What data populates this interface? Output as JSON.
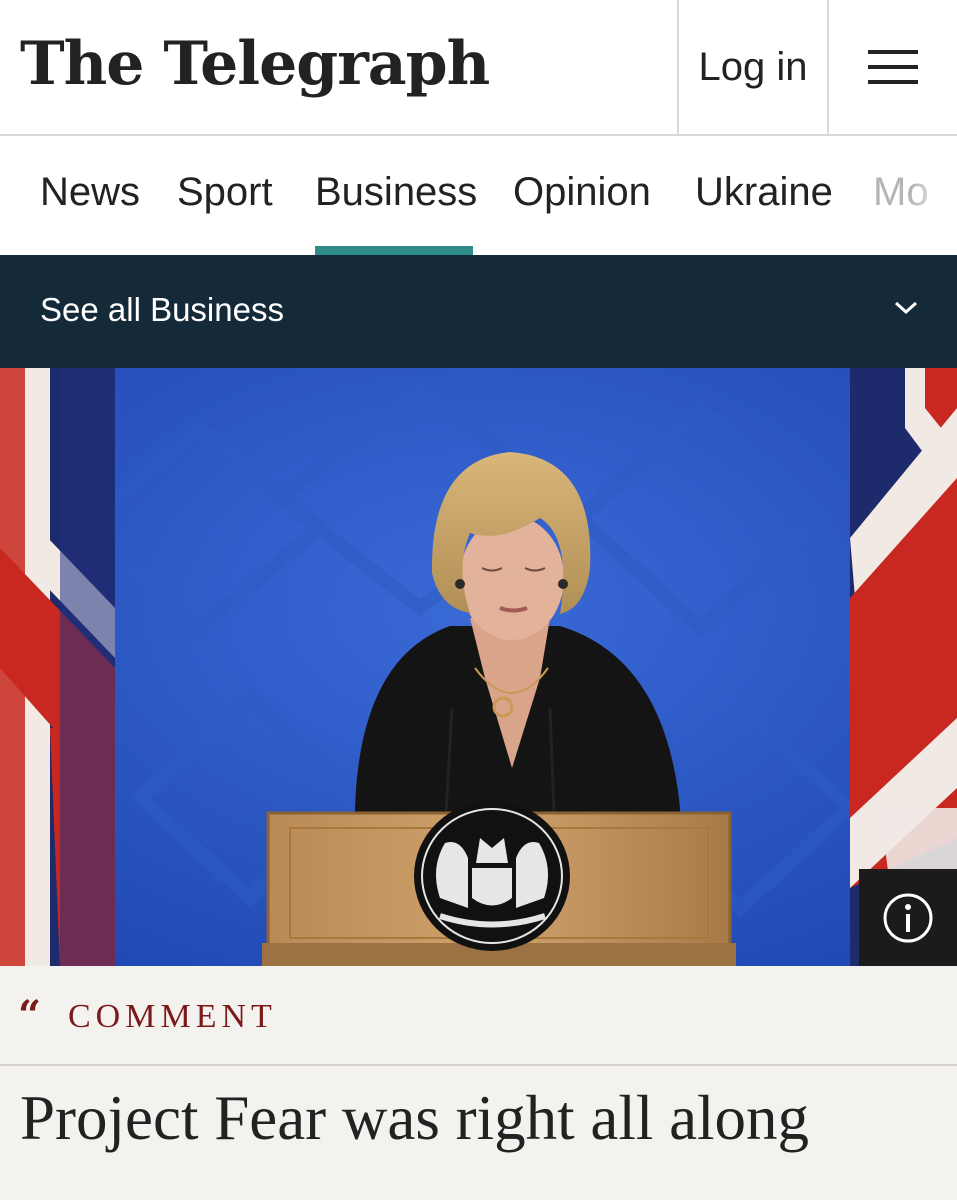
{
  "header": {
    "logo": "The Telegraph",
    "login_label": "Log in",
    "menu_icon": "hamburger-menu-icon"
  },
  "nav": {
    "items": [
      {
        "label": "News"
      },
      {
        "label": "Sport"
      },
      {
        "label": "Business",
        "active": true
      },
      {
        "label": "Opinion"
      },
      {
        "label": "Ukraine"
      },
      {
        "label": "Mo"
      }
    ],
    "active_color": "#2f8c88"
  },
  "subnav": {
    "label": "See all Business",
    "icon": "chevron-down-icon",
    "background": "#152a38"
  },
  "hero": {
    "info_icon": "info-icon"
  },
  "article": {
    "kicker_icon": "quote-icon",
    "kicker": "COMMENT",
    "kicker_color": "#7a1b1b",
    "headline": "Project Fear was right all along"
  }
}
